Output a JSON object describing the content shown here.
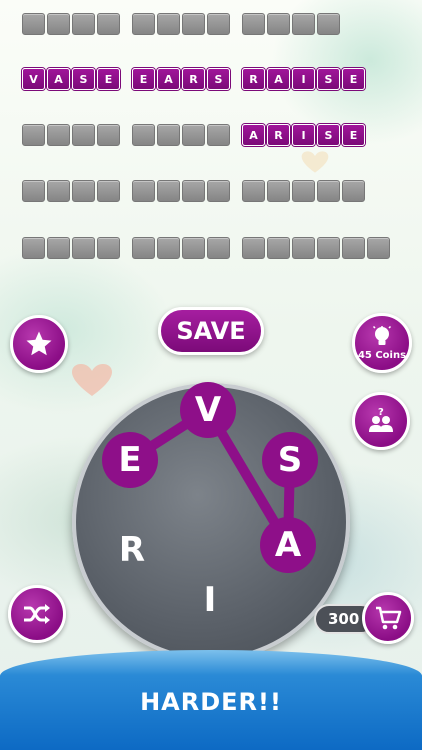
{
  "colors": {
    "accent_purple": "#8e0f89",
    "tile_gray": "#8f8f8f",
    "wheel_gray": "#5a6068",
    "banner_blue": "#0d6ac4"
  },
  "board": {
    "rows": [
      {
        "words": [
          {
            "letters": [
              "",
              "",
              "",
              ""
            ],
            "found": false
          },
          {
            "letters": [
              "",
              "",
              "",
              ""
            ],
            "found": false
          },
          {
            "letters": [
              "",
              "",
              "",
              ""
            ],
            "found": false
          }
        ]
      },
      {
        "words": [
          {
            "letters": [
              "V",
              "A",
              "S",
              "E"
            ],
            "found": true
          },
          {
            "letters": [
              "E",
              "A",
              "R",
              "S"
            ],
            "found": true
          },
          {
            "letters": [
              "R",
              "A",
              "I",
              "S",
              "E"
            ],
            "found": true
          }
        ]
      },
      {
        "words": [
          {
            "letters": [
              "",
              "",
              "",
              ""
            ],
            "found": false
          },
          {
            "letters": [
              "",
              "",
              "",
              ""
            ],
            "found": false
          },
          {
            "letters": [
              "A",
              "R",
              "I",
              "S",
              "E"
            ],
            "found": true
          }
        ]
      },
      {
        "words": [
          {
            "letters": [
              "",
              "",
              "",
              ""
            ],
            "found": false
          },
          {
            "letters": [
              "",
              "",
              "",
              ""
            ],
            "found": false
          },
          {
            "letters": [
              "",
              "",
              "",
              "",
              ""
            ],
            "found": false
          }
        ]
      },
      {
        "words": [
          {
            "letters": [
              "",
              "",
              "",
              ""
            ],
            "found": false
          },
          {
            "letters": [
              "",
              "",
              "",
              ""
            ],
            "found": false
          },
          {
            "letters": [
              "",
              "",
              "",
              "",
              "",
              ""
            ],
            "found": false
          }
        ]
      }
    ]
  },
  "buttons": {
    "save_label": "SAVE",
    "favorite_icon": "star-icon",
    "hint_icon": "lightbulb-icon",
    "hint_label": "45 Coins",
    "friends_icon": "ask-friends-icon",
    "shuffle_icon": "shuffle-icon",
    "shop_icon": "cart-icon"
  },
  "wheel": {
    "letters": [
      {
        "char": "V",
        "selected": true
      },
      {
        "char": "E",
        "selected": true
      },
      {
        "char": "S",
        "selected": true
      },
      {
        "char": "R",
        "selected": false
      },
      {
        "char": "A",
        "selected": true
      },
      {
        "char": "I",
        "selected": false
      }
    ]
  },
  "coins": {
    "balance": "300"
  },
  "banner": {
    "text": "HARDER!!"
  }
}
